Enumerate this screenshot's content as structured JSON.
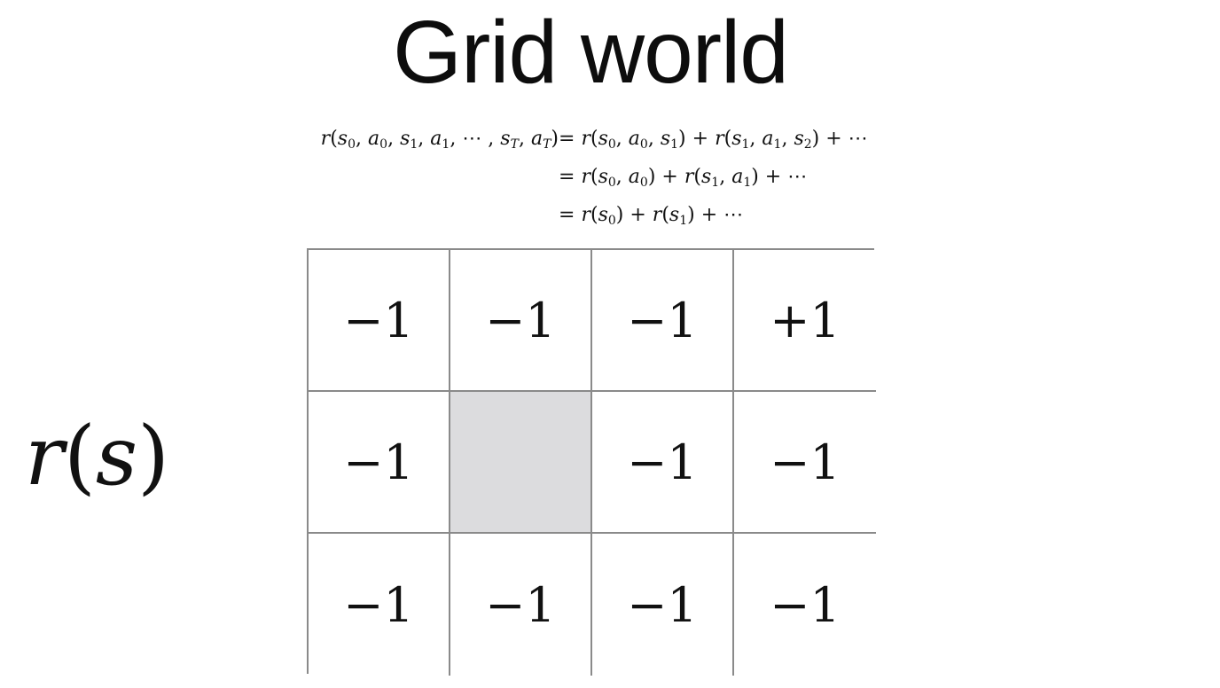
{
  "title": "Grid world",
  "equations": {
    "line1_lhs": "r(s0, a0, s1, a1, ⋯ , sT, aT)",
    "line1_rhs": "= r(s0, a0, s1) + r(s1, a1, s2) + ⋯",
    "line2_rhs": "= r(s0, a0) + r(s1, a1) + ⋯",
    "line3_rhs": "= r(s0) + r(s1) + ⋯"
  },
  "reward_label": "r(s)",
  "grid": {
    "rows": [
      [
        "−1",
        "−1",
        "−1",
        "+1"
      ],
      [
        "−1",
        "",
        "−1",
        "−1"
      ],
      [
        "−1",
        "−1",
        "−1",
        "−1"
      ]
    ],
    "wall_color": "#dcdcde",
    "border_color": "#8a8a8a"
  }
}
